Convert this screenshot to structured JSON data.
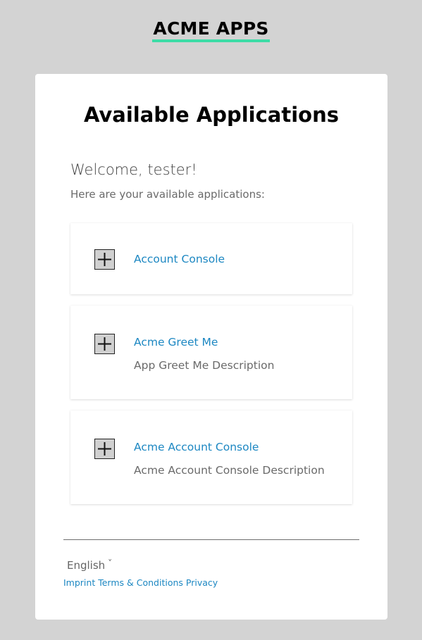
{
  "header": {
    "brand": "ACME APPS",
    "accent_color": "#3ddca6"
  },
  "card": {
    "title": "Available Applications",
    "welcome": "Welcome, tester!",
    "subtitle": "Here are your available applications:"
  },
  "applications": [
    {
      "name": "Account Console",
      "description": "",
      "icon": "plus-icon"
    },
    {
      "name": "Acme Greet Me",
      "description": "App Greet Me Description",
      "icon": "plus-icon"
    },
    {
      "name": "Acme Account Console",
      "description": "Acme Account Console Description",
      "icon": "plus-icon"
    }
  ],
  "footer": {
    "language": "English",
    "language_icon": "chevron-down-icon",
    "links": [
      "Imprint",
      "Terms & Conditions",
      "Privacy"
    ]
  },
  "colors": {
    "background": "#d3d3d3",
    "link": "#1c87c2"
  }
}
